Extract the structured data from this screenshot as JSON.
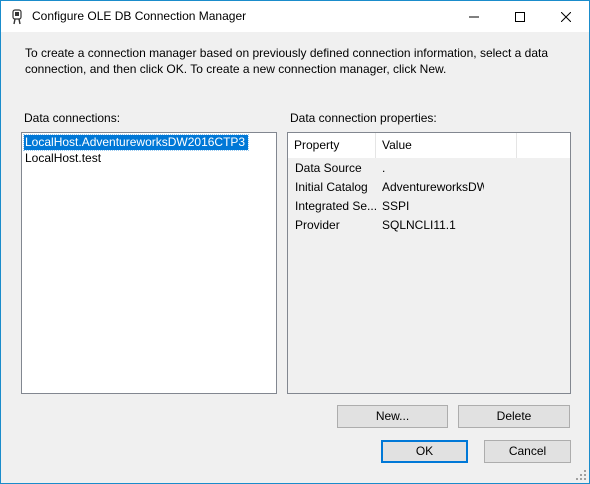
{
  "window": {
    "title": "Configure OLE DB Connection Manager",
    "accent_color": "#1a8ccb",
    "icon": "ssis-connection-icon"
  },
  "intro_text": "To create a connection manager based on previously defined connection information, select a data connection, and then click OK. To create a new connection manager, click New.",
  "data_connections": {
    "label": "Data connections:",
    "items": [
      {
        "label": "LocalHost.AdventureworksDW2016CTP3",
        "selected": true
      },
      {
        "label": "LocalHost.test",
        "selected": false
      }
    ],
    "selection_color": "#0078d7"
  },
  "properties": {
    "label": "Data connection properties:",
    "columns": [
      "Property",
      "Value"
    ],
    "rows": [
      {
        "property": "Data Source",
        "value": "."
      },
      {
        "property": "Initial Catalog",
        "value": "AdventureworksDW20..."
      },
      {
        "property": "Integrated Se...",
        "value": "SSPI"
      },
      {
        "property": "Provider",
        "value": "SQLNCLI11.1"
      }
    ]
  },
  "buttons": {
    "new": "New...",
    "delete": "Delete",
    "ok": "OK",
    "cancel": "Cancel"
  }
}
